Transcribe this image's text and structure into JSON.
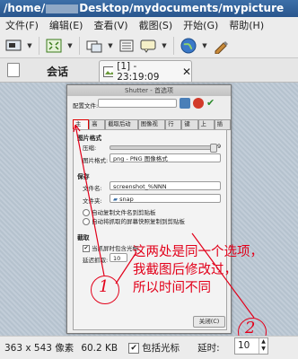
{
  "window": {
    "title_prefix": "/home/",
    "title_suffix": "Desktop/mydocuments/mypicture"
  },
  "menubar": {
    "items": [
      "文件(F)",
      "编辑(E)",
      "查看(V)",
      "截图(S)",
      "开始(G)",
      "帮助(H)"
    ]
  },
  "sidebar": {
    "session_label": "会话"
  },
  "tabs": [
    {
      "label": "[1] - 23:19:09"
    }
  ],
  "dialog": {
    "title": "Shutter - 首选项",
    "profile_label": "配置文件:",
    "tabs": [
      "主要",
      "高级",
      "截取后动作",
      "图像视图",
      "行为",
      "键盘",
      "上传",
      "插件"
    ],
    "image_format_heading": "图片格式",
    "compression_label": "压缩:",
    "compression_value": "9",
    "format_label": "图片格式:",
    "format_value": "png - PNG 图像格式",
    "save_heading": "保存",
    "filename_label": "文件名:",
    "filename_value": "screenshot_%NNN",
    "folder_label": "文件夹:",
    "folder_value": "snap",
    "radio_clipboard_file": "自动复制文件名到剪贴板",
    "radio_clipboard_image": "自动将抓取的屏幕快照复制到剪贴板",
    "capture_heading": "截取",
    "include_cursor_label": "当抓屏时包含光标",
    "delay_label": "延迟抓取:",
    "delay_value": "10",
    "close_button": "关闭(C)"
  },
  "annotation": {
    "text_line1": "这两处是同一个选项，",
    "text_line2": "我截图后修改过，",
    "text_line3": "所以时间不同",
    "marker1": "1",
    "marker2": "2"
  },
  "statusbar": {
    "dimensions": "363 x 543 像素",
    "filesize": "60.2 KB",
    "include_cursor_label": "包括光标",
    "include_cursor_checked": true,
    "delay_label": "延时:",
    "delay_value": "10"
  }
}
